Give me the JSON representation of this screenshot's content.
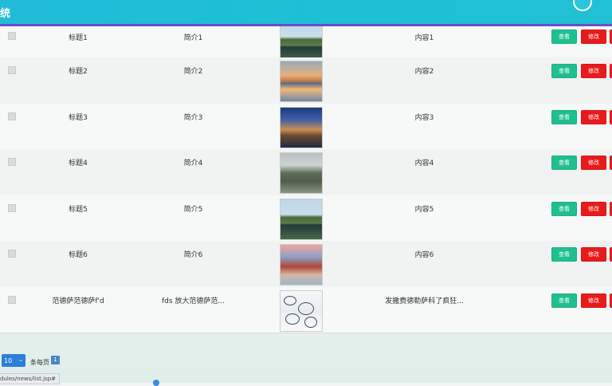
{
  "header": {
    "title": "统"
  },
  "rows": [
    {
      "title": "标题1",
      "intro": "简介1",
      "content": "内容1",
      "view": "查看",
      "edit": "修改",
      "thumb": "tA"
    },
    {
      "title": "标题2",
      "intro": "简介2",
      "content": "内容2",
      "view": "查看",
      "edit": "修改",
      "thumb": "tB"
    },
    {
      "title": "标题3",
      "intro": "简介3",
      "content": "内容3",
      "view": "查看",
      "edit": "修改",
      "thumb": "tC"
    },
    {
      "title": "标题4",
      "intro": "简介4",
      "content": "内容4",
      "view": "查看",
      "edit": "修改",
      "thumb": "tD"
    },
    {
      "title": "标题5",
      "intro": "简介5",
      "content": "内容5",
      "view": "查看",
      "edit": "修改",
      "thumb": "tA"
    },
    {
      "title": "标题6",
      "intro": "简介6",
      "content": "内容6",
      "view": "查看",
      "edit": "修改",
      "thumb": "tF"
    },
    {
      "title": "范德萨范德萨f'd",
      "intro": "fds 放大范德萨范...",
      "content": "发撒费德勒萨科了疯狂...",
      "view": "查看",
      "edit": "修改",
      "thumb": "tG"
    }
  ],
  "footer": {
    "page_size": "10",
    "per_page_label": "条每页",
    "current_page": "1"
  },
  "status_url": "dules/news/list.jsp#"
}
